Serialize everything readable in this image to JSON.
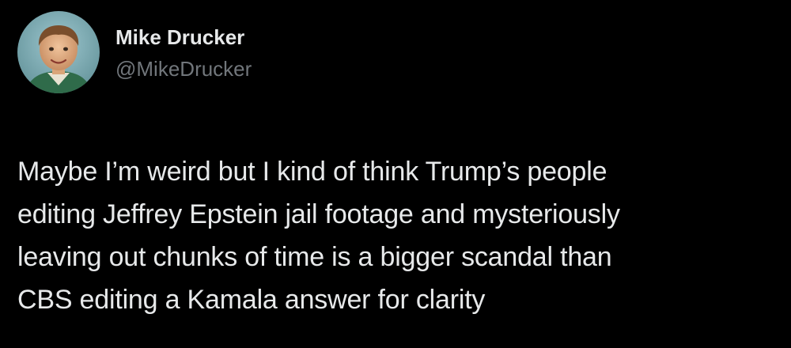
{
  "author": {
    "display_name": "Mike Drucker",
    "handle": "@MikeDrucker",
    "avatar_icon": "child-portrait-avatar"
  },
  "tweet": {
    "lines": [
      "Maybe I’m weird but I kind of think Trump’s people",
      "editing Jeffrey Epstein jail footage and mysteriously",
      "leaving out chunks of time is a bigger scandal than",
      "CBS editing a Kamala answer for clarity"
    ]
  },
  "colors": {
    "background": "#000000",
    "primary_text": "#e7e9ea",
    "secondary_text": "#71767b"
  }
}
